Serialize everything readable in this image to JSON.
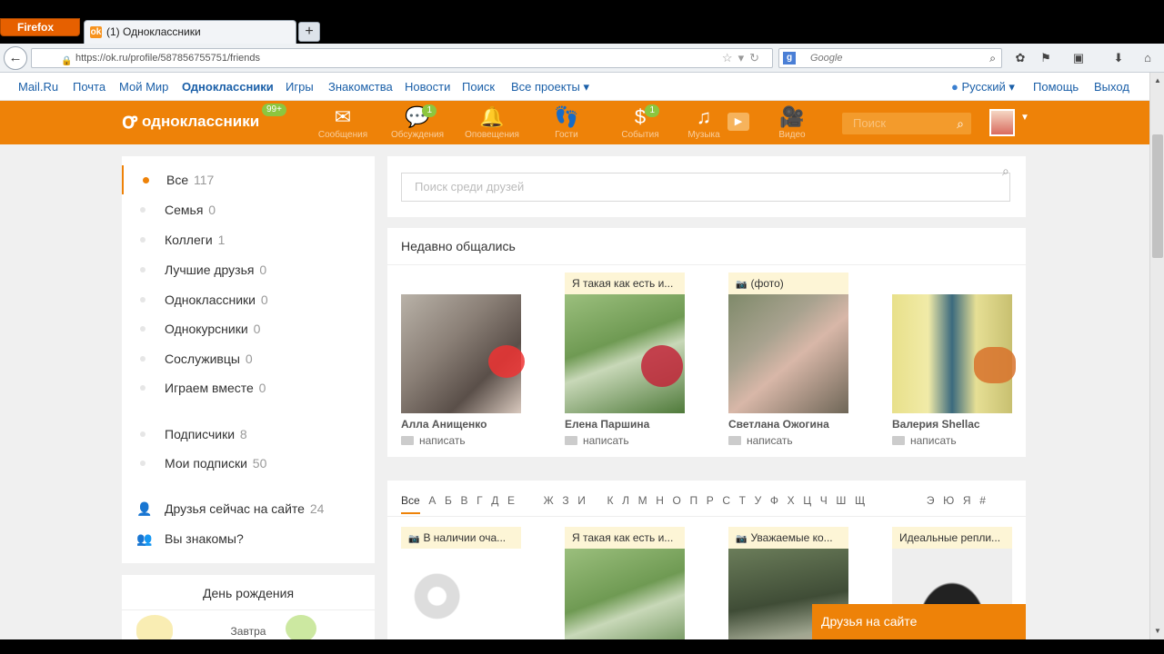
{
  "browser": {
    "app_button": "Firefox",
    "tab_title": "(1) Одноклассники",
    "new_tab": "+",
    "back": "←",
    "url": "https://ok.ru/profile/587856755751/friends",
    "search_engine_letter": "g",
    "search_placeholder": "Google"
  },
  "mailbar": {
    "links": [
      "Mail.Ru",
      "Почта",
      "Мой Мир",
      "Одноклассники",
      "Игры",
      "Знакомства",
      "Новости",
      "Поиск",
      "Все проекты ▾"
    ],
    "language": "Русский ▾",
    "help": "Помощь",
    "logout": "Выход"
  },
  "header": {
    "logo": "одноклассники",
    "logo_badge": "99+",
    "nav": [
      {
        "label": "Сообщения",
        "icon": "envelope-icon",
        "badge": ""
      },
      {
        "label": "Обсуждения",
        "icon": "discussions-icon",
        "badge": "1"
      },
      {
        "label": "Оповещения",
        "icon": "bell-icon",
        "badge": ""
      },
      {
        "label": "Гости",
        "icon": "footprints-icon",
        "badge": ""
      },
      {
        "label": "События",
        "icon": "events-icon",
        "badge": "1"
      },
      {
        "label": "Музыка",
        "icon": "music-icon",
        "badge": ""
      },
      {
        "label": "Видео",
        "icon": "video-icon",
        "badge": ""
      }
    ],
    "search_placeholder": "Поиск"
  },
  "sidebar": {
    "groups": [
      {
        "label": "Все",
        "count": "117"
      },
      {
        "label": "Семья",
        "count": "0"
      },
      {
        "label": "Коллеги",
        "count": "1"
      },
      {
        "label": "Лучшие друзья",
        "count": "0"
      },
      {
        "label": "Одноклассники",
        "count": "0"
      },
      {
        "label": "Однокурсники",
        "count": "0"
      },
      {
        "label": "Сослуживцы",
        "count": "0"
      },
      {
        "label": "Играем вместе",
        "count": "0"
      }
    ],
    "subscriptions": [
      {
        "label": "Подписчики",
        "count": "8"
      },
      {
        "label": "Мои подписки",
        "count": "50"
      }
    ],
    "extra": [
      {
        "label": "Друзья сейчас на сайте",
        "count": "24"
      },
      {
        "label": "Вы знакомы?",
        "count": ""
      }
    ]
  },
  "birthday": {
    "title": "День рождения",
    "subtitle": "Завтра"
  },
  "friends_search": {
    "placeholder": "Поиск среди друзей"
  },
  "recent": {
    "title": "Недавно общались",
    "write_label": "написать",
    "friends": [
      {
        "name": "Алла Анищенко",
        "status": ""
      },
      {
        "name": "Елена Паршина",
        "status": "Я такая как есть и..."
      },
      {
        "name": "Светлана Ожогина",
        "status": "(фото)"
      },
      {
        "name": "Валерия Shellac",
        "status": ""
      }
    ]
  },
  "alphabet": {
    "letters": [
      "Все",
      "А",
      "Б",
      "В",
      "Г",
      "Д",
      "Е",
      "Ж",
      "З",
      "И",
      "К",
      "Л",
      "М",
      "Н",
      "О",
      "П",
      "Р",
      "С",
      "Т",
      "У",
      "Ф",
      "Х",
      "Ц",
      "Ч",
      "Ш",
      "Щ",
      "Э",
      "Ю",
      "Я",
      "#"
    ],
    "statuses": [
      "В наличии оча...",
      "Я такая как есть и...",
      "Уважаемые ко...",
      "Идеальные репли..."
    ]
  },
  "online_bar": "Друзья на сайте",
  "colors": {
    "ok_orange": "#ee8208",
    "link_blue": "#1a5fa8",
    "badge_green": "#8cc63f"
  }
}
